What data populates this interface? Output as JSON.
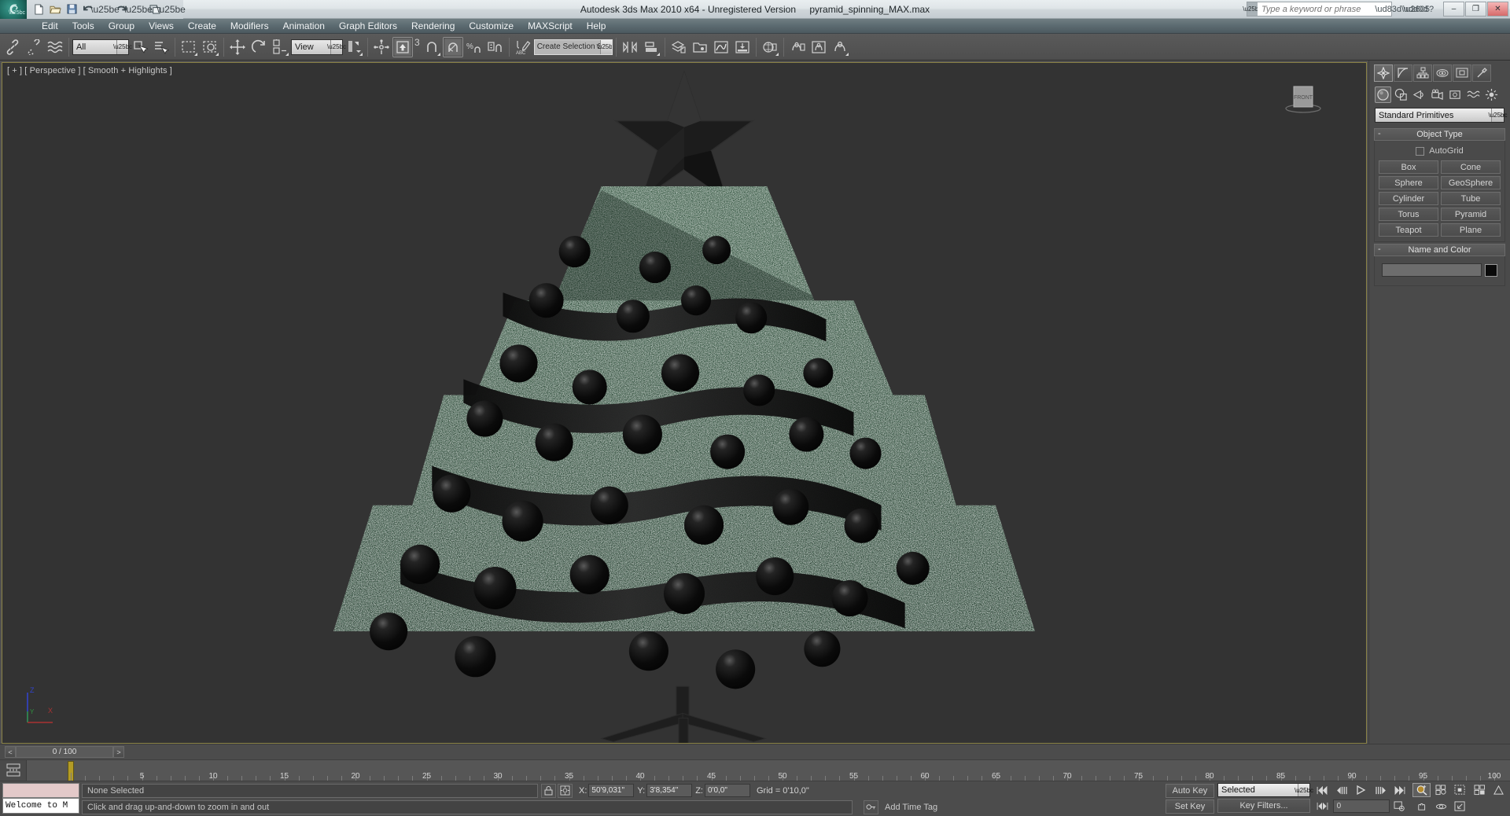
{
  "title_bar": {
    "app_title": "Autodesk 3ds Max  2010 x64  - Unregistered Version",
    "file_name": "pyramid_spinning_MAX.max",
    "search_placeholder": "Type a keyword or phrase",
    "logo_icon": "max-logo-icon",
    "quick_access": [
      {
        "name": "new-file-icon",
        "glyph": "⬜"
      },
      {
        "name": "open-file-icon",
        "glyph": "📂"
      },
      {
        "name": "save-file-icon",
        "glyph": "💾"
      },
      {
        "name": "undo-icon",
        "glyph": "↶"
      },
      {
        "name": "redo-icon",
        "glyph": "↷"
      },
      {
        "name": "project-folder-icon",
        "glyph": "🗂"
      }
    ],
    "window_buttons": [
      {
        "name": "minimize-button",
        "glyph": "–"
      },
      {
        "name": "maximize-button",
        "glyph": "❐"
      },
      {
        "name": "close-button",
        "glyph": "✕"
      }
    ]
  },
  "menu_bar": {
    "items": [
      {
        "label": "Edit"
      },
      {
        "label": "Tools"
      },
      {
        "label": "Group"
      },
      {
        "label": "Views"
      },
      {
        "label": "Create"
      },
      {
        "label": "Modifiers"
      },
      {
        "label": "Animation"
      },
      {
        "label": "Graph Editors"
      },
      {
        "label": "Rendering"
      },
      {
        "label": "Customize"
      },
      {
        "label": "MAXScript"
      },
      {
        "label": "Help"
      }
    ]
  },
  "toolbar": {
    "selection_filter": "All",
    "reference_coord_system": "View",
    "named_selection_set": "Create Selection Se",
    "snap_toggle_number": "3",
    "buttons": [
      {
        "name": "select-and-link-button"
      },
      {
        "name": "unlink-selection-button"
      },
      {
        "name": "bind-to-space-warp-button"
      },
      {
        "name": "select-object-button"
      },
      {
        "name": "select-by-name-button"
      },
      {
        "name": "rectangular-selection-region-button"
      },
      {
        "name": "window-crossing-button"
      },
      {
        "name": "select-and-move-button"
      },
      {
        "name": "select-and-rotate-button"
      },
      {
        "name": "select-and-scale-button"
      },
      {
        "name": "use-pivot-point-center-button"
      },
      {
        "name": "select-and-manipulate-button"
      },
      {
        "name": "keyboard-shortcut-override-toggle-button"
      },
      {
        "name": "snaps-toggle-button"
      },
      {
        "name": "angle-snap-toggle-button"
      },
      {
        "name": "percent-snap-toggle-button"
      },
      {
        "name": "spinner-snap-toggle-button"
      },
      {
        "name": "edit-named-selection-sets-button"
      },
      {
        "name": "mirror-button"
      },
      {
        "name": "align-button"
      },
      {
        "name": "layer-manager-button"
      },
      {
        "name": "curve-editor-button"
      },
      {
        "name": "schematic-view-button"
      },
      {
        "name": "material-editor-button"
      },
      {
        "name": "render-setup-button"
      },
      {
        "name": "rendered-frame-window-button"
      },
      {
        "name": "render-production-button"
      }
    ]
  },
  "viewport": {
    "label": "[ + ] [ Perspective ] [ Smooth + Highlights ]",
    "viewcube_face": "FRONT",
    "axis_labels": {
      "z": "Z",
      "y": "Y",
      "x": "X"
    },
    "axis_colors": {
      "x": "#aa3333",
      "y": "#2f8f3f",
      "z": "#3344cc"
    },
    "background_color": "#333333",
    "border_color": "#8b8347",
    "scene_description": "Christmas tree with black star topper, dark ornaments and ribbon garland",
    "scene_colors": {
      "foliage": "#1d3326",
      "foliage_dark": "#101d16",
      "ornament": "#0b0b0b",
      "ornament_highlight": "#4a4a4a",
      "ribbon": "#141414",
      "star": "#1a1a1a",
      "stand": "#222222"
    }
  },
  "command_panel": {
    "tabs": [
      {
        "name": "create-tab",
        "selected": true
      },
      {
        "name": "modify-tab",
        "selected": false
      },
      {
        "name": "hierarchy-tab",
        "selected": false
      },
      {
        "name": "motion-tab",
        "selected": false
      },
      {
        "name": "display-tab",
        "selected": false
      },
      {
        "name": "utilities-tab",
        "selected": false
      }
    ],
    "categories": [
      {
        "name": "geometry-category",
        "selected": true
      },
      {
        "name": "shapes-category",
        "selected": false
      },
      {
        "name": "lights-category",
        "selected": false
      },
      {
        "name": "cameras-category",
        "selected": false
      },
      {
        "name": "helpers-category",
        "selected": false
      },
      {
        "name": "space-warps-category",
        "selected": false
      },
      {
        "name": "systems-category",
        "selected": false
      }
    ],
    "category_dropdown": "Standard Primitives",
    "object_type": {
      "title": "Object Type",
      "autogrid_label": "AutoGrid",
      "buttons": [
        "Box",
        "Cone",
        "Sphere",
        "GeoSphere",
        "Cylinder",
        "Tube",
        "Torus",
        "Pyramid",
        "Teapot",
        "Plane"
      ]
    },
    "name_and_color": {
      "title": "Name and Color",
      "name_value": "",
      "color_swatch": "#0a0a0a"
    }
  },
  "timeline": {
    "frame_indicator": "0 / 100",
    "prev_arrow": "<",
    "next_arrow": ">",
    "tick_labels": [
      "5",
      "10",
      "15",
      "20",
      "25",
      "30",
      "35",
      "40",
      "45",
      "50",
      "55",
      "60",
      "65",
      "70",
      "75",
      "80",
      "85",
      "90",
      "95",
      "100"
    ],
    "tick_values": [
      5,
      10,
      15,
      20,
      25,
      30,
      35,
      40,
      45,
      50,
      55,
      60,
      65,
      70,
      75,
      80,
      85,
      90,
      95,
      100
    ],
    "range_start": 0,
    "range_end": 100,
    "current_frame": 0
  },
  "status_bar": {
    "maxscript_mini_listener": "Welcome to M",
    "selection_status": "None Selected",
    "prompt_line": "Click and drag up-and-down to zoom in and out",
    "coordinates": [
      {
        "axis": "X:",
        "value": "50'9,031\""
      },
      {
        "axis": "Y:",
        "value": "3'8,354\""
      },
      {
        "axis": "Z:",
        "value": "0'0,0\""
      }
    ],
    "grid_text": "Grid = 0'10,0\"",
    "add_time_tag": "Add Time Tag",
    "lock_selection_icon": "lock-icon",
    "absolute_relative_icon": "absolute-mode-transform-type-in-icon"
  },
  "animation": {
    "auto_key_label": "Auto Key",
    "set_key_label": "Set Key",
    "key_filters_label": "Key Filters...",
    "selection_level": "Selected",
    "current_frame_field": "0",
    "playback_buttons": [
      {
        "name": "go-to-start-button",
        "glyph": "⏮"
      },
      {
        "name": "previous-frame-button",
        "glyph": "⏪"
      },
      {
        "name": "play-animation-button",
        "glyph": "▶"
      },
      {
        "name": "next-frame-button",
        "glyph": "⏩"
      },
      {
        "name": "go-to-end-button",
        "glyph": "⏭"
      }
    ],
    "nav_buttons": [
      {
        "name": "zoom-button",
        "selected": true
      },
      {
        "name": "zoom-all-button",
        "selected": false
      },
      {
        "name": "zoom-extents-button",
        "selected": false
      },
      {
        "name": "zoom-extents-all-button",
        "selected": false
      },
      {
        "name": "field-of-view-button",
        "selected": false
      },
      {
        "name": "pan-view-button",
        "selected": false
      },
      {
        "name": "orbit-button",
        "selected": false
      },
      {
        "name": "maximize-viewport-toggle-button",
        "selected": false
      }
    ]
  }
}
